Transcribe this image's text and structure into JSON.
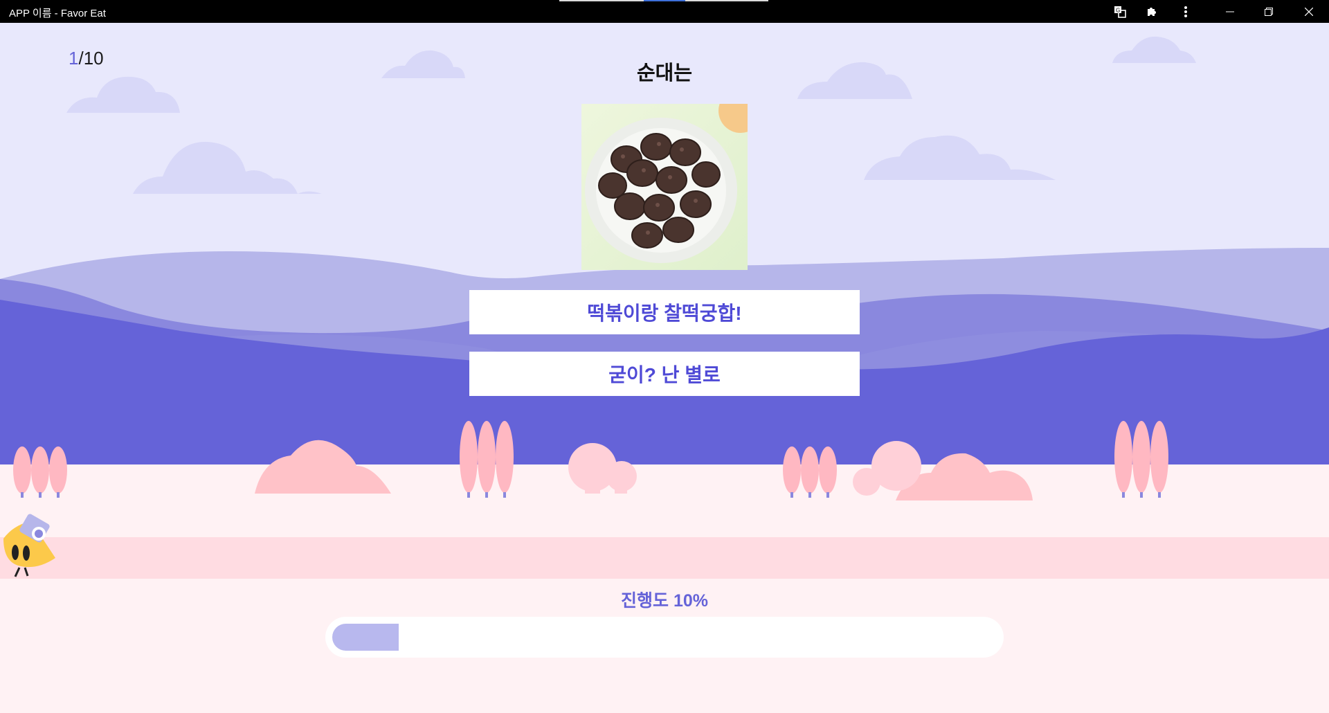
{
  "window": {
    "title": "APP 이름 - Favor Eat"
  },
  "quiz": {
    "current": "1",
    "total": "/10",
    "question": "순대는",
    "image_alt": "순대 사진",
    "answers": [
      {
        "label": "떡볶이랑 찰떡궁합!"
      },
      {
        "label": "굳이? 난 별로"
      }
    ]
  },
  "progress": {
    "label": "진행도 10%",
    "fraction": 0.1
  },
  "colors": {
    "accent": "#6563d8",
    "sky": "#e8e8fc",
    "cloud": "#d8d8f8",
    "mountain_back": "#b6b6ea",
    "mountain_mid": "#8a88de",
    "mountain_front": "#6563d8",
    "ground": "#fff2f4",
    "path": "#ffdce2",
    "tree": "#ffb8c2",
    "bush": "#ffc2c8"
  },
  "icons": {
    "translate": "translate-icon",
    "extensions": "puzzle-icon",
    "menu": "more-vert-icon",
    "minimize": "minimize-icon",
    "restore": "restore-icon",
    "close": "close-icon",
    "mascot": "mascot-icon"
  }
}
